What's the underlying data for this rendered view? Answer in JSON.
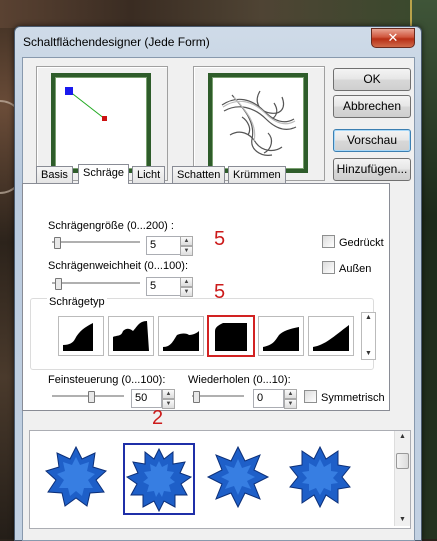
{
  "window": {
    "title": "Schaltflächendesigner (Jede Form)",
    "close_label": "✕"
  },
  "buttons": {
    "ok": "OK",
    "cancel": "Abbrechen",
    "preview": "Vorschau",
    "add": "Hinzufügen..."
  },
  "tabs": [
    "Basis",
    "Schräge",
    "Licht",
    "Schatten",
    "Krümmen"
  ],
  "bevel": {
    "size_label": "Schrägengröße (0...200) :",
    "size_value": "5",
    "softness_label": "Schrägenweichheit (0...100):",
    "softness_value": "5",
    "pressed_label": "Gedrückt",
    "outside_label": "Außen",
    "type_label": "Schrägetyp",
    "fine_label": "Feinsteuerung (0...100):",
    "fine_value": "50",
    "repeat_label": "Wiederholen (0...10):",
    "repeat_value": "0",
    "symmetric_label": "Symmetrisch"
  },
  "annotations": {
    "a1": "5",
    "a2": "5",
    "a3": "2"
  },
  "colors": {
    "accent_red": "#cc1b1b",
    "frame_green": "#2e5c2a",
    "star_blue": "#1e5fc8"
  }
}
